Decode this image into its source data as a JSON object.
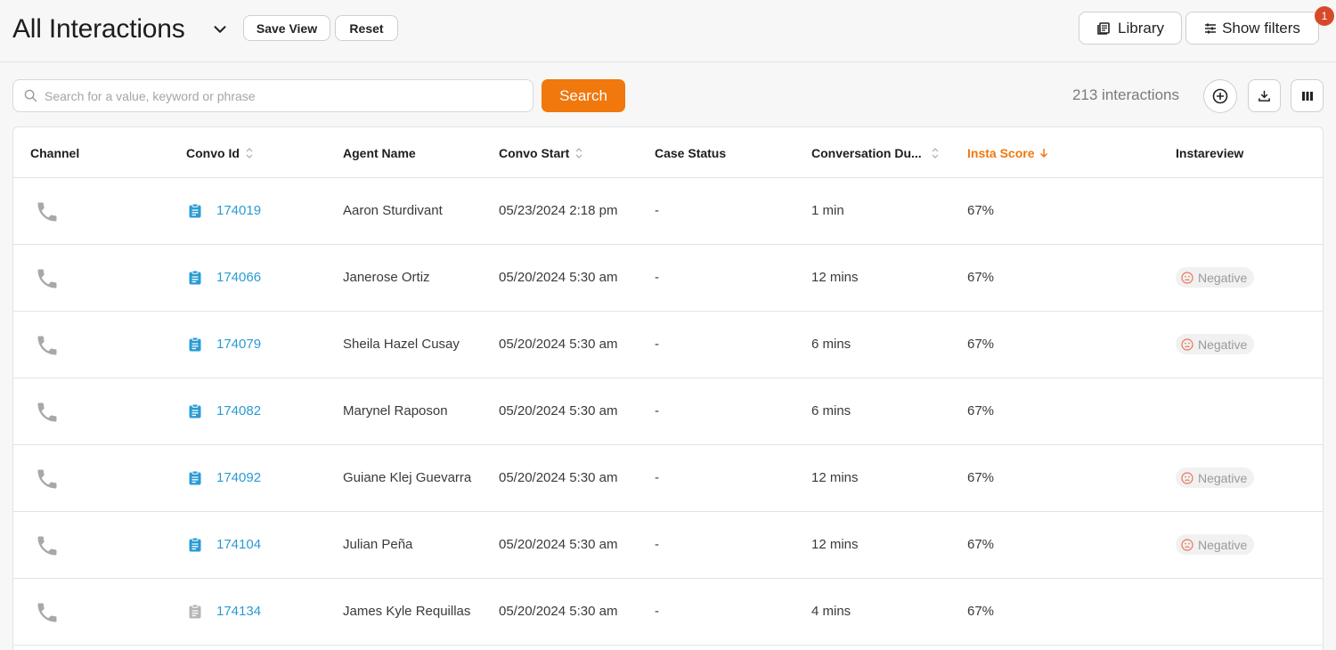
{
  "header": {
    "title": "All Interactions",
    "save_view": "Save View",
    "reset": "Reset",
    "library": "Library",
    "show_filters": "Show filters",
    "filter_badge": "1"
  },
  "toolbar": {
    "search_placeholder": "Search for a value, keyword or phrase",
    "search_button": "Search",
    "count": "213 interactions"
  },
  "table": {
    "columns": [
      "Channel",
      "Convo Id",
      "Agent Name",
      "Convo Start",
      "Case Status",
      "Conversation Du...",
      "Insta Score",
      "Instareview"
    ],
    "rows": [
      {
        "id": "174019",
        "agent": "Aaron Sturdivant",
        "start": "05/23/2024 2:18 pm",
        "status": "-",
        "duration": "1 min",
        "score": "67%",
        "review": ""
      },
      {
        "id": "174066",
        "agent": "Janerose Ortiz",
        "start": "05/20/2024 5:30 am",
        "status": "-",
        "duration": "12 mins",
        "score": "67%",
        "review": "Negative"
      },
      {
        "id": "174079",
        "agent": "Sheila Hazel Cusay",
        "start": "05/20/2024 5:30 am",
        "status": "-",
        "duration": "6 mins",
        "score": "67%",
        "review": "Negative"
      },
      {
        "id": "174082",
        "agent": "Marynel Raposon",
        "start": "05/20/2024 5:30 am",
        "status": "-",
        "duration": "6 mins",
        "score": "67%",
        "review": ""
      },
      {
        "id": "174092",
        "agent": "Guiane Klej Guevarra",
        "start": "05/20/2024 5:30 am",
        "status": "-",
        "duration": "12 mins",
        "score": "67%",
        "review": "Negative"
      },
      {
        "id": "174104",
        "agent": "Julian Peña",
        "start": "05/20/2024 5:30 am",
        "status": "-",
        "duration": "12 mins",
        "score": "67%",
        "review": "Negative"
      },
      {
        "id": "174134",
        "agent": "James Kyle Requillas",
        "start": "05/20/2024 5:30 am",
        "status": "-",
        "duration": "4 mins",
        "score": "67%",
        "review": ""
      }
    ]
  },
  "colors": {
    "accent": "#f0780d",
    "link": "#2a9bd4",
    "badge": "#d64a2a"
  }
}
